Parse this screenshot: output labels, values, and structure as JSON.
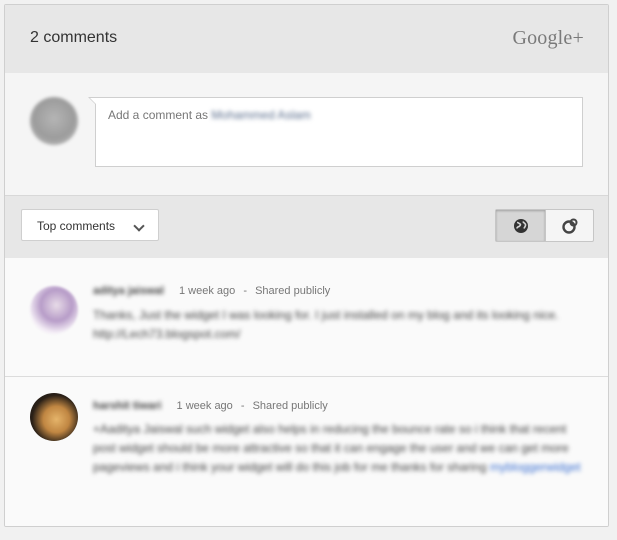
{
  "header": {
    "comment_count": "2 comments",
    "brand": "Google+"
  },
  "composer": {
    "placeholder": "Add a comment as",
    "user_name": "Mohammed Aslam"
  },
  "toolbar": {
    "sort_label": "Top comments",
    "sort_icon": "chevron-down-icon",
    "toggle_icons": [
      "globe-icon",
      "google-circles-icon"
    ]
  },
  "comments": [
    {
      "author": "aditya jaiswal",
      "time": "1 week ago",
      "separator": "-",
      "visibility": "Shared publicly",
      "text": "Thanks, Just the widget I was looking for. I just installed on my blog and its looking nice. http://Lech73.blogspot.com/"
    },
    {
      "author": "harshit tiwari",
      "time": "1 week ago",
      "separator": "-",
      "visibility": "Shared publicly",
      "text": "+Aaditya Jaiswal such widget also helps in reducing the bounce rate so i think that recent post widget should be more attractive so that it can engage the user and we can get more pageviews and i think your widget will do this job for me thanks for sharing",
      "link_text": "mybloggerwidget"
    }
  ]
}
